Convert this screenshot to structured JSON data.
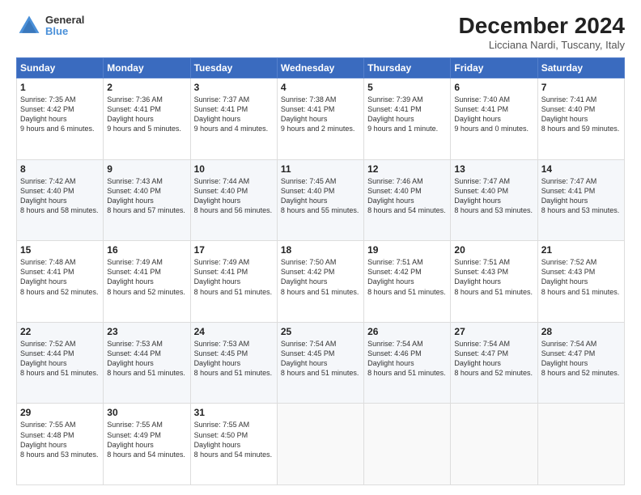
{
  "logo": {
    "line1": "General",
    "line2": "Blue"
  },
  "title": "December 2024",
  "subtitle": "Licciana Nardi, Tuscany, Italy",
  "days": [
    "Sunday",
    "Monday",
    "Tuesday",
    "Wednesday",
    "Thursday",
    "Friday",
    "Saturday"
  ],
  "weeks": [
    [
      {
        "day": "1",
        "sunrise": "7:35 AM",
        "sunset": "4:42 PM",
        "daylight": "9 hours and 6 minutes."
      },
      {
        "day": "2",
        "sunrise": "7:36 AM",
        "sunset": "4:41 PM",
        "daylight": "9 hours and 5 minutes."
      },
      {
        "day": "3",
        "sunrise": "7:37 AM",
        "sunset": "4:41 PM",
        "daylight": "9 hours and 4 minutes."
      },
      {
        "day": "4",
        "sunrise": "7:38 AM",
        "sunset": "4:41 PM",
        "daylight": "9 hours and 2 minutes."
      },
      {
        "day": "5",
        "sunrise": "7:39 AM",
        "sunset": "4:41 PM",
        "daylight": "9 hours and 1 minute."
      },
      {
        "day": "6",
        "sunrise": "7:40 AM",
        "sunset": "4:41 PM",
        "daylight": "9 hours and 0 minutes."
      },
      {
        "day": "7",
        "sunrise": "7:41 AM",
        "sunset": "4:40 PM",
        "daylight": "8 hours and 59 minutes."
      }
    ],
    [
      {
        "day": "8",
        "sunrise": "7:42 AM",
        "sunset": "4:40 PM",
        "daylight": "8 hours and 58 minutes."
      },
      {
        "day": "9",
        "sunrise": "7:43 AM",
        "sunset": "4:40 PM",
        "daylight": "8 hours and 57 minutes."
      },
      {
        "day": "10",
        "sunrise": "7:44 AM",
        "sunset": "4:40 PM",
        "daylight": "8 hours and 56 minutes."
      },
      {
        "day": "11",
        "sunrise": "7:45 AM",
        "sunset": "4:40 PM",
        "daylight": "8 hours and 55 minutes."
      },
      {
        "day": "12",
        "sunrise": "7:46 AM",
        "sunset": "4:40 PM",
        "daylight": "8 hours and 54 minutes."
      },
      {
        "day": "13",
        "sunrise": "7:47 AM",
        "sunset": "4:40 PM",
        "daylight": "8 hours and 53 minutes."
      },
      {
        "day": "14",
        "sunrise": "7:47 AM",
        "sunset": "4:41 PM",
        "daylight": "8 hours and 53 minutes."
      }
    ],
    [
      {
        "day": "15",
        "sunrise": "7:48 AM",
        "sunset": "4:41 PM",
        "daylight": "8 hours and 52 minutes."
      },
      {
        "day": "16",
        "sunrise": "7:49 AM",
        "sunset": "4:41 PM",
        "daylight": "8 hours and 52 minutes."
      },
      {
        "day": "17",
        "sunrise": "7:49 AM",
        "sunset": "4:41 PM",
        "daylight": "8 hours and 51 minutes."
      },
      {
        "day": "18",
        "sunrise": "7:50 AM",
        "sunset": "4:42 PM",
        "daylight": "8 hours and 51 minutes."
      },
      {
        "day": "19",
        "sunrise": "7:51 AM",
        "sunset": "4:42 PM",
        "daylight": "8 hours and 51 minutes."
      },
      {
        "day": "20",
        "sunrise": "7:51 AM",
        "sunset": "4:43 PM",
        "daylight": "8 hours and 51 minutes."
      },
      {
        "day": "21",
        "sunrise": "7:52 AM",
        "sunset": "4:43 PM",
        "daylight": "8 hours and 51 minutes."
      }
    ],
    [
      {
        "day": "22",
        "sunrise": "7:52 AM",
        "sunset": "4:44 PM",
        "daylight": "8 hours and 51 minutes."
      },
      {
        "day": "23",
        "sunrise": "7:53 AM",
        "sunset": "4:44 PM",
        "daylight": "8 hours and 51 minutes."
      },
      {
        "day": "24",
        "sunrise": "7:53 AM",
        "sunset": "4:45 PM",
        "daylight": "8 hours and 51 minutes."
      },
      {
        "day": "25",
        "sunrise": "7:54 AM",
        "sunset": "4:45 PM",
        "daylight": "8 hours and 51 minutes."
      },
      {
        "day": "26",
        "sunrise": "7:54 AM",
        "sunset": "4:46 PM",
        "daylight": "8 hours and 51 minutes."
      },
      {
        "day": "27",
        "sunrise": "7:54 AM",
        "sunset": "4:47 PM",
        "daylight": "8 hours and 52 minutes."
      },
      {
        "day": "28",
        "sunrise": "7:54 AM",
        "sunset": "4:47 PM",
        "daylight": "8 hours and 52 minutes."
      }
    ],
    [
      {
        "day": "29",
        "sunrise": "7:55 AM",
        "sunset": "4:48 PM",
        "daylight": "8 hours and 53 minutes."
      },
      {
        "day": "30",
        "sunrise": "7:55 AM",
        "sunset": "4:49 PM",
        "daylight": "8 hours and 54 minutes."
      },
      {
        "day": "31",
        "sunrise": "7:55 AM",
        "sunset": "4:50 PM",
        "daylight": "8 hours and 54 minutes."
      },
      null,
      null,
      null,
      null
    ]
  ]
}
